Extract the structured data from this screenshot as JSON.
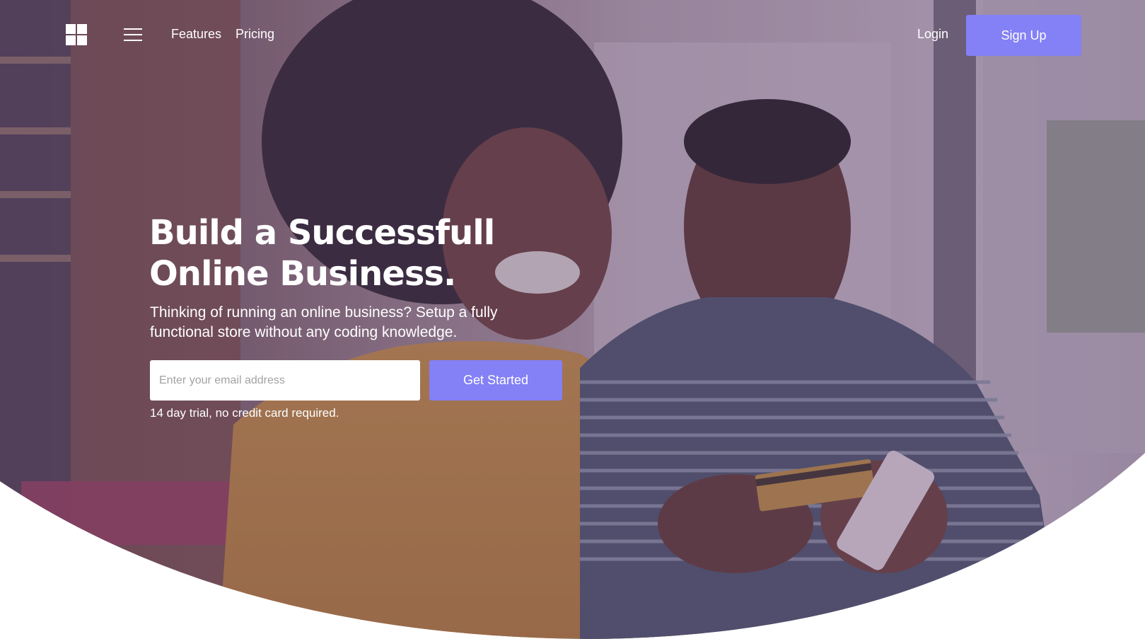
{
  "nav": {
    "logo_icon": "windows-grid-icon",
    "menu_icon": "hamburger-menu-icon",
    "links": [
      {
        "label": "Features"
      },
      {
        "label": "Pricing"
      }
    ],
    "login_label": "Login",
    "signup_label": "Sign Up"
  },
  "hero": {
    "headline_line1": "Build a Successfull",
    "headline_line2": "Online Business.",
    "subtext_line1": "Thinking of running an online business? Setup a fully",
    "subtext_line2": "functional store without any coding knowledge.",
    "email_placeholder": "Enter your email address",
    "email_value": "",
    "cta_label": "Get Started",
    "trial_note": "14 day trial, no credit card required."
  },
  "colors": {
    "accent": "#8480f5",
    "overlay": "#5c4a78",
    "background": "#ffffff"
  }
}
